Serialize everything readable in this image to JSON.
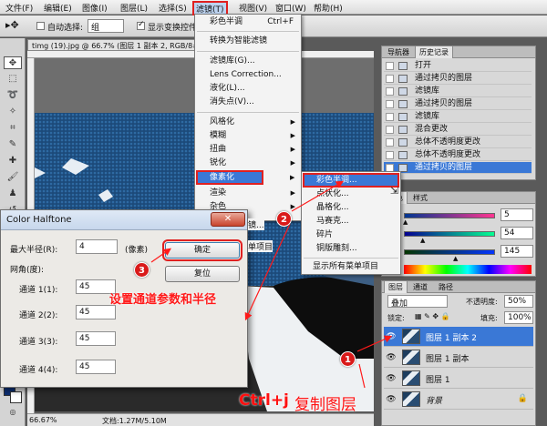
{
  "menubar": {
    "items": [
      "文件(F)",
      "编辑(E)",
      "图像(I)",
      "图层(L)",
      "选择(S)",
      "滤镜(T)",
      "视图(V)",
      "窗口(W)",
      "帮助(H)"
    ]
  },
  "options_bar": {
    "auto_select_label": "自动选择:",
    "auto_select_value": "组",
    "show_transform_label": "显示变换控件"
  },
  "document": {
    "tab_title": "timg (19).jpg @ 66.7% (图层 1 副本 2, RGB/8#)",
    "zoom": "66.67%",
    "doc_size": "文档:1.27M/5.10M"
  },
  "filter_menu": {
    "items": [
      {
        "label": "彩色半调",
        "shortcut": "Ctrl+F"
      },
      {
        "label": "转换为智能滤镜"
      },
      {
        "label": "滤镜库(G)..."
      },
      {
        "label": "Lens Correction..."
      },
      {
        "label": "液化(L)..."
      },
      {
        "label": "消失点(V)..."
      },
      {
        "label": "风格化",
        "submenu": true
      },
      {
        "label": "模糊",
        "submenu": true
      },
      {
        "label": "扭曲",
        "submenu": true
      },
      {
        "label": "锐化",
        "submenu": true
      },
      {
        "label": "像素化",
        "submenu": true,
        "highlighted": true
      },
      {
        "label": "渲染",
        "submenu": true
      },
      {
        "label": "杂色",
        "submenu": true
      }
    ],
    "behind_dialog": [
      "镜...",
      "单项目"
    ]
  },
  "pixelate_submenu": {
    "items": [
      "彩色半调...",
      "点状化...",
      "晶格化...",
      "马赛克...",
      "碎片",
      "铜版雕刻..."
    ],
    "footer": "显示所有菜单项目"
  },
  "history_panel": {
    "tabs": [
      "导航器",
      "历史记录"
    ],
    "rows": [
      "打开",
      "通过拷贝的图层",
      "滤镜库",
      "通过拷贝的图层",
      "滤镜库",
      "混合更改",
      "总体不透明度更改",
      "总体不透明度更改",
      "通过拷贝的图层"
    ]
  },
  "color_panel": {
    "tabs": [
      "颜色",
      "样式"
    ],
    "channels": [
      {
        "name": "R",
        "value": "5"
      },
      {
        "name": "G",
        "value": "54"
      },
      {
        "name": "B",
        "value": "145"
      }
    ],
    "thumb_positions": [
      0.02,
      0.21,
      0.57
    ],
    "track_colors": [
      "#000000",
      "#ff0000"
    ]
  },
  "layers_panel": {
    "tabs": [
      "图层",
      "通道",
      "路径"
    ],
    "blend_mode": "叠加",
    "opacity_label": "不透明度:",
    "opacity": "50%",
    "lock_label": "锁定:",
    "fill_label": "填充:",
    "fill": "100%",
    "layers": [
      "图层 1 副本 2",
      "图层 1 副本",
      "图层 1",
      "背景"
    ]
  },
  "dialog": {
    "title": "Color Halftone",
    "max_radius_label": "最大半径(R):",
    "max_radius_value": "4",
    "unit": "(像素)",
    "angles_label": "网角(度):",
    "channels": [
      {
        "label": "通道 1(1):",
        "value": "45"
      },
      {
        "label": "通道 2(2):",
        "value": "45"
      },
      {
        "label": "通道 3(3):",
        "value": "45"
      },
      {
        "label": "通道 4(4):",
        "value": "45"
      }
    ],
    "ok": "确定",
    "reset": "复位"
  },
  "annotations": {
    "step1": "1",
    "step2": "2",
    "step3": "3",
    "text_params": "设置通道参数和半径",
    "text_ctrlj_key": "Ctrl+j",
    "text_ctrlj_rest": "复制图层",
    "color": "#ff1a1a"
  }
}
